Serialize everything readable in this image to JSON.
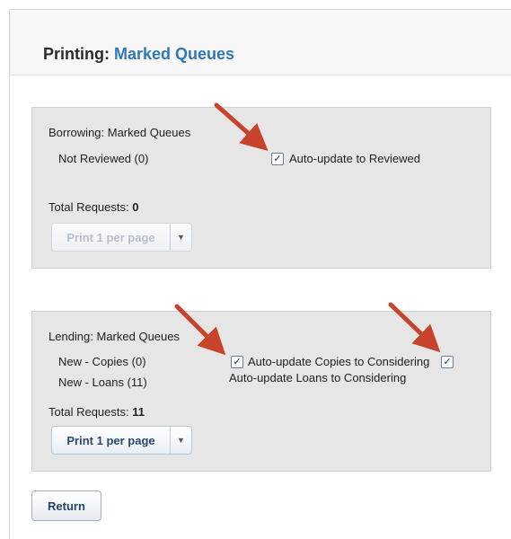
{
  "header": {
    "title_prefix": "Printing:",
    "title_accent": "Marked Queues"
  },
  "borrowing": {
    "heading": "Borrowing: Marked Queues",
    "queues": [
      "Not Reviewed (0)"
    ],
    "auto_update_label": "Auto-update to Reviewed",
    "auto_update_checked": true,
    "total_label": "Total Requests:",
    "total_value": "0",
    "print_button_label": "Print 1 per page",
    "print_button_disabled": true
  },
  "lending": {
    "heading": "Lending: Marked Queues",
    "queues": [
      "New - Copies (0)",
      "New - Loans (11)"
    ],
    "auto_update_copies_label": "Auto-update Copies to Considering",
    "auto_update_copies_checked": true,
    "auto_update_loans_label": "Auto-update Loans to Considering",
    "auto_update_loans_checked": true,
    "total_label": "Total Requests:",
    "total_value": "11",
    "print_button_label": "Print 1 per page",
    "print_button_disabled": false
  },
  "footer": {
    "return_label": "Return"
  },
  "icons": {
    "checkbox_check": "check-icon",
    "dropdown": "chevron-down-icon",
    "annotation": "red-arrow-icon"
  },
  "colors": {
    "title_accent": "#2e78b6",
    "panel_background": "#e6e6e6",
    "annotation_arrow": "#c8432b"
  }
}
